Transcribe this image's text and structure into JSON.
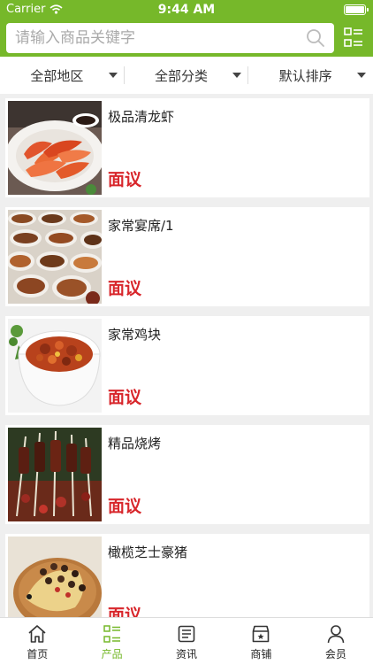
{
  "status_bar": {
    "carrier": "Carrier",
    "time": "9:44 AM"
  },
  "search": {
    "placeholder": "请输入商品关键字"
  },
  "filters": [
    {
      "label": "全部地区"
    },
    {
      "label": "全部分类"
    },
    {
      "label": "默认排序"
    }
  ],
  "products": [
    {
      "title": "极品清龙虾",
      "price": "面议"
    },
    {
      "title": "家常宴席/1",
      "price": "面议"
    },
    {
      "title": "家常鸡块",
      "price": "面议"
    },
    {
      "title": "精品烧烤",
      "price": "面议"
    },
    {
      "title": "橄榄芝士豪猪",
      "price": "面议"
    }
  ],
  "tabs": [
    {
      "label": "首页",
      "icon": "home-icon"
    },
    {
      "label": "产品",
      "icon": "grid-list-icon",
      "active": true
    },
    {
      "label": "资讯",
      "icon": "news-icon"
    },
    {
      "label": "商铺",
      "icon": "shop-icon"
    },
    {
      "label": "会员",
      "icon": "user-icon"
    }
  ],
  "colors": {
    "brand_green": "#76b82a",
    "price_red": "#d8262b",
    "background": "#efefef"
  }
}
